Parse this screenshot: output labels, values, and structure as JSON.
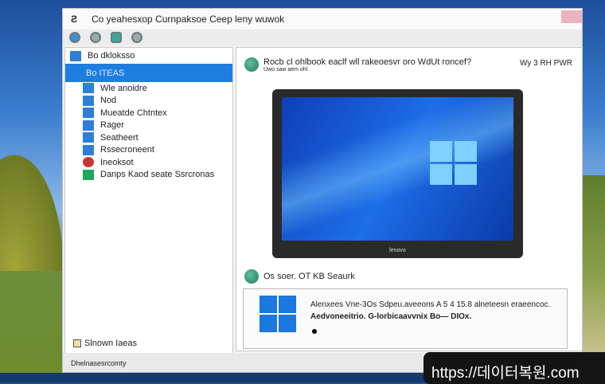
{
  "window": {
    "title": "Co yeahesxop Curnpaksoe Ceep leny wuwok"
  },
  "sidebar": {
    "header": "Bo dkloksso",
    "items": [
      {
        "label": "Bo ITEAS",
        "selected": true
      },
      {
        "label": "Wle anoidre"
      },
      {
        "label": "Nod"
      },
      {
        "label": "Mueatde Chtntex"
      },
      {
        "label": "Rager"
      },
      {
        "label": "Seatheert"
      },
      {
        "label": "Rssecroneent"
      },
      {
        "label": "Ineoksot"
      },
      {
        "label": "Danps Kaod seate Ssrcronas"
      }
    ],
    "footer": "Slnown Iaeas"
  },
  "main": {
    "header": "Rocb cl ohlbook eaclf wll rakeoesvr oro WdUt roncef?",
    "subheader": "Uwo saw aem ohl",
    "header_right": "Wy 3 RH PWR",
    "laptop_brand": "lenovo",
    "section_title": "Os soer. OT KB Seaurk",
    "box_lines": [
      "Alenxees Vne-3Os Sdpeu.aveeons A 5 4 15.8 alneteesn eraeencoc.",
      "Aedvoneeitrio. G-lorbicaavvnix Bo— DIOx."
    ]
  },
  "status": "Dhelnasesrcomty",
  "watermark": "https://데이터복원.com",
  "colors": {
    "accent": "#1e7ee0",
    "windows_blue": "#1a78e0"
  }
}
